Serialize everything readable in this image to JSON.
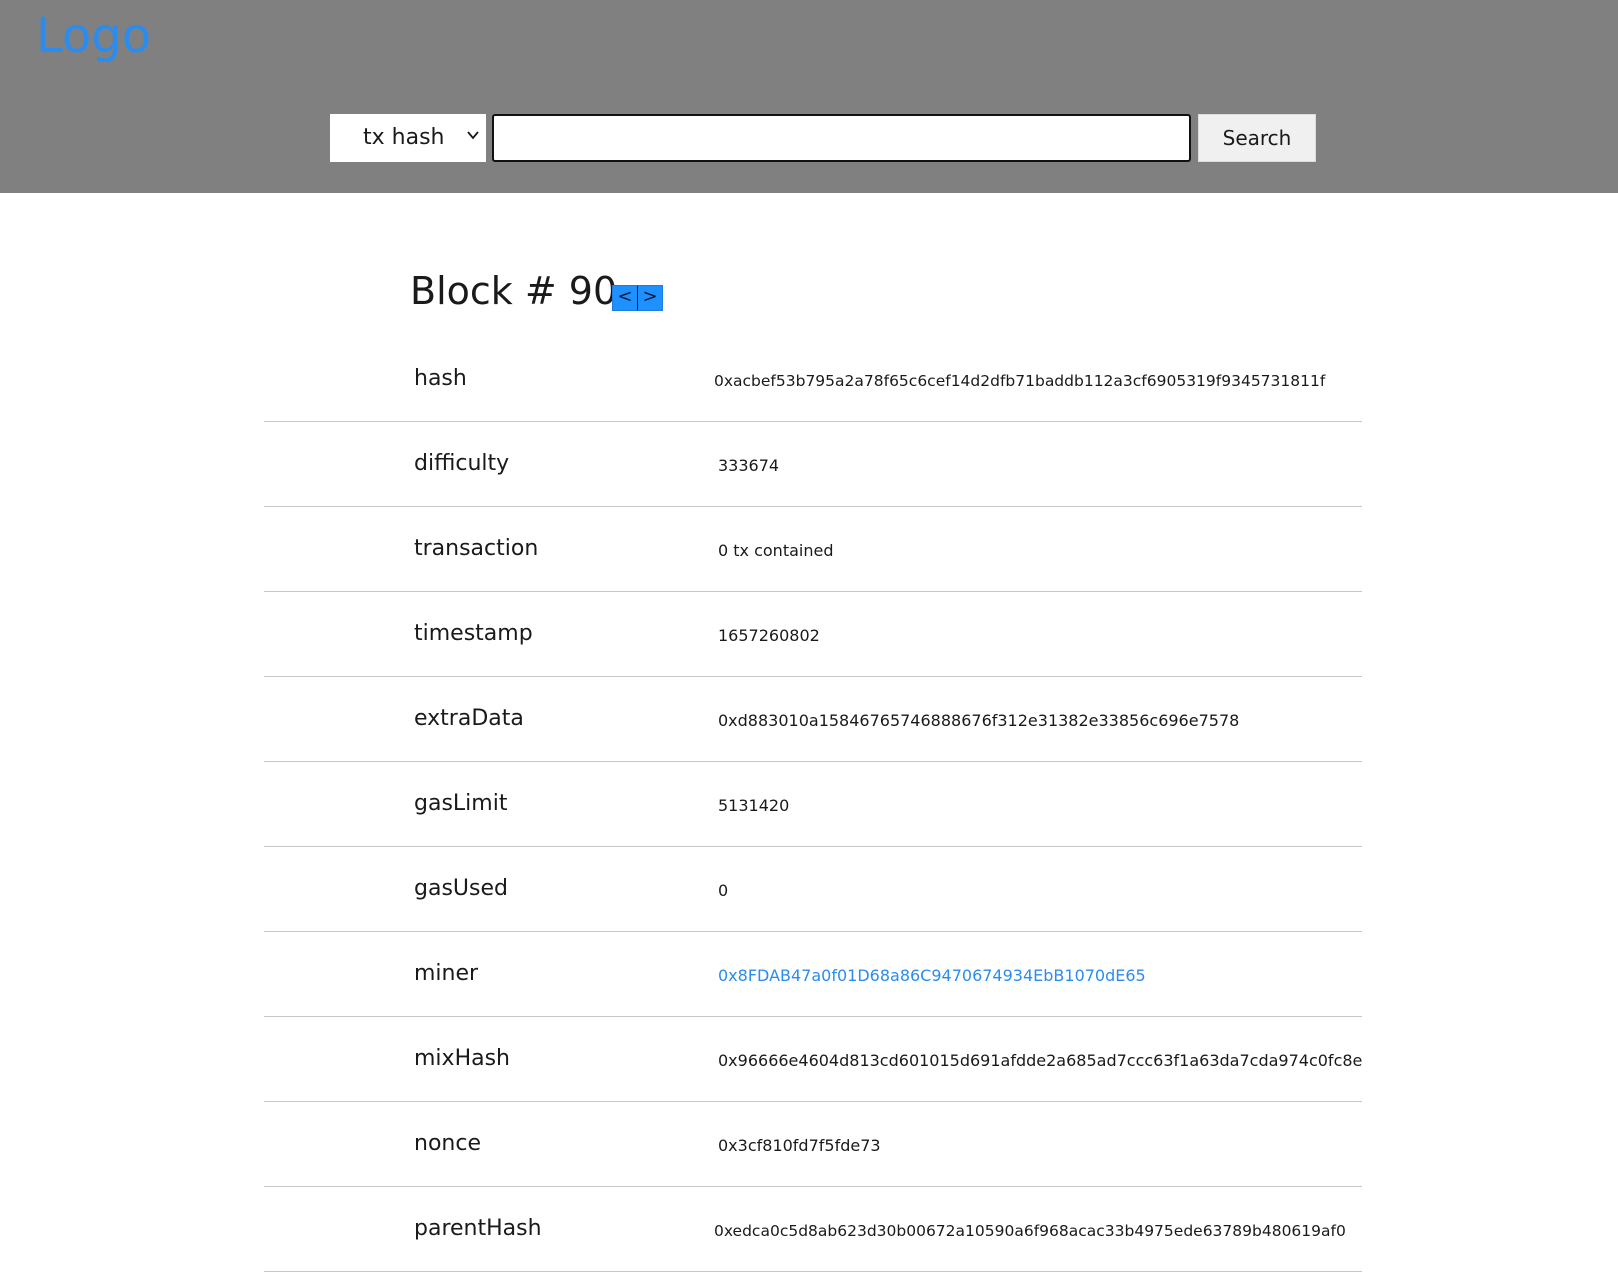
{
  "header": {
    "logo": "Logo",
    "search": {
      "select_value": "tx hash",
      "input_value": "",
      "input_placeholder": "",
      "button_label": "Search"
    },
    "background_color": "#808080",
    "accent_color": "#2b8cf0"
  },
  "block": {
    "title": "Block # 90",
    "prev_label": "<",
    "next_label": ">"
  },
  "rows": [
    {
      "label": "hash",
      "value": "0xacbef53b795a2a78f65c6cef14d2dfb71baddb112a3cf6905319f9345731811f"
    },
    {
      "label": "difficulty",
      "value": "333674"
    },
    {
      "label": "transaction",
      "value": "0 tx contained"
    },
    {
      "label": "timestamp",
      "value": "1657260802"
    },
    {
      "label": "extraData",
      "value": "0xd883010a15846765746888676f312e31382e33856c696e7578"
    },
    {
      "label": "gasLimit",
      "value": "5131420"
    },
    {
      "label": "gasUsed",
      "value": "0"
    },
    {
      "label": "miner",
      "value": "0x8FDAB47a0f01D68a86C9470674934EbB1070dE65"
    },
    {
      "label": "mixHash",
      "value": "0x96666e4604d813cd601015d691afdde2a685ad7ccc63f1a63da7cda974c0fc8e"
    },
    {
      "label": "nonce",
      "value": "0x3cf810fd7f5fde73"
    },
    {
      "label": "parentHash",
      "value": "0xedca0c5d8ab623d30b00672a10590a6f968acac33b4975ede63789b480619af0"
    }
  ]
}
